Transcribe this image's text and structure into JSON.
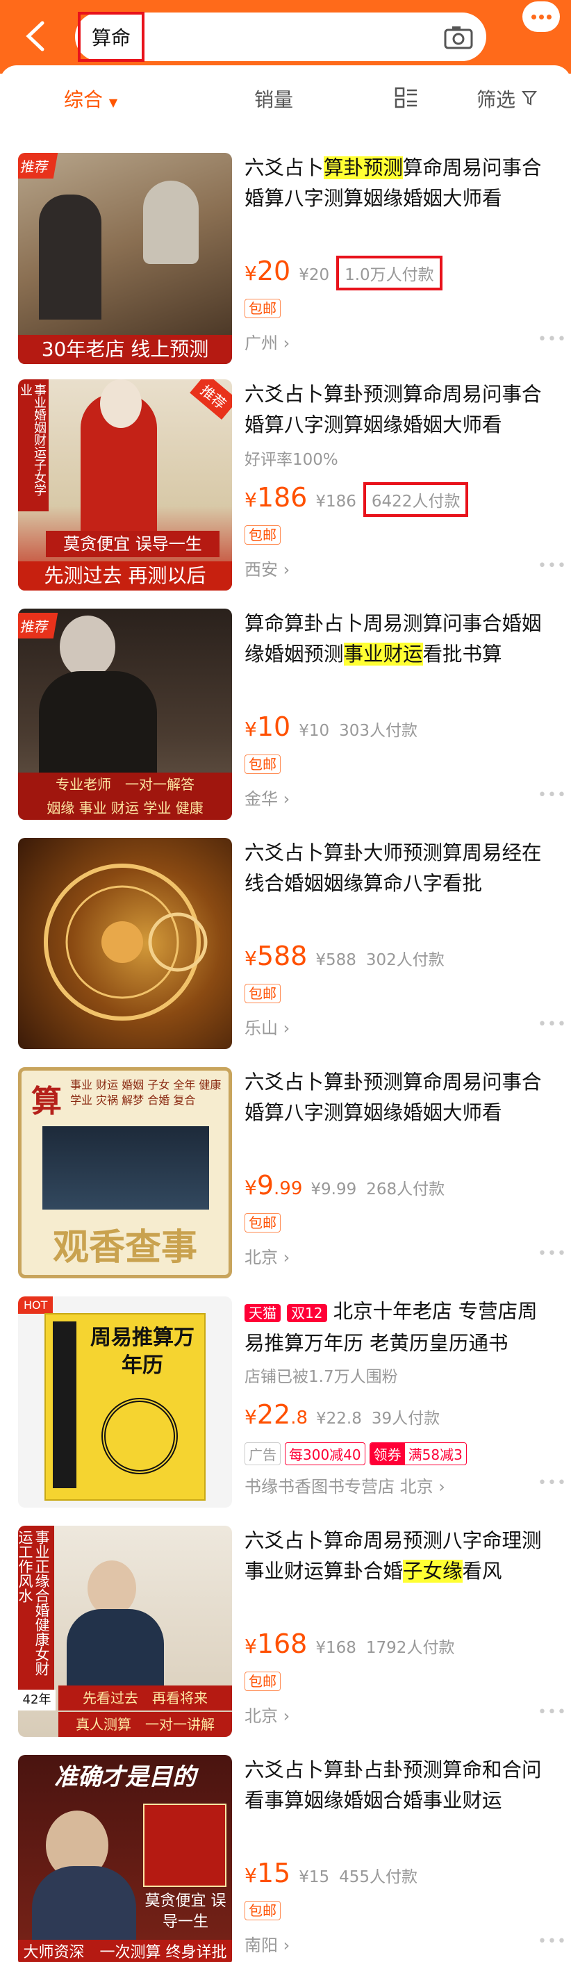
{
  "search": {
    "query": "算命"
  },
  "tabs": {
    "comprehensive": "综合",
    "sales": "销量",
    "filter": "筛选"
  },
  "products": [
    {
      "title_pre": "六爻占卜",
      "title_hl": "算卦预测",
      "title_post": "算命周易问事合婚算八字测算姻缘婚姻大师看",
      "price_int": "20",
      "price_dec": "",
      "orig": "¥20",
      "paid": "1.0万人付款",
      "paid_boxed": true,
      "tag": "包邮",
      "loc": "广州",
      "thumb_badge": "推荐",
      "thumb_caption": "30年老店 线上预测"
    },
    {
      "title_pre": "六爻占卜算卦预测算命周易问事合婚算八字测算姻缘婚姻大师看",
      "title_hl": "",
      "title_post": "",
      "sub": "好评率100%",
      "price_int": "186",
      "price_dec": "",
      "orig": "¥186",
      "paid": "6422人付款",
      "paid_boxed": true,
      "tag": "包邮",
      "loc": "西安",
      "thumb_badge": "推荐",
      "thumb_side": "事业婚姻财运子女学业",
      "thumb_caption1": "莫贪便宜 误导一生",
      "thumb_caption": "先测过去 再测以后"
    },
    {
      "title_pre": "算命算卦占卜周易测算问事合婚姻缘婚姻预测",
      "title_hl": "事业财运",
      "title_post": "看批书算",
      "price_int": "10",
      "price_dec": "",
      "orig": "¥10",
      "paid": "303人付款",
      "tag": "包邮",
      "loc": "金华",
      "thumb_badge": "推荐",
      "thumb_caption1": "专业老师　一对一解答",
      "thumb_caption": "姻缘 事业 财运 学业 健康"
    },
    {
      "title_pre": "六爻占卜算卦大师预测算周易经在线合婚姻姻缘算命八字看批",
      "title_hl": "",
      "title_post": "",
      "price_int": "588",
      "price_dec": "",
      "orig": "¥588",
      "paid": "302人付款",
      "tag": "包邮",
      "loc": "乐山"
    },
    {
      "title_pre": "六爻占卜算卦预测算命周易问事合婚算八字测算姻缘婚姻大师看",
      "title_hl": "",
      "title_post": "",
      "price_int": "9",
      "price_dec": ".99",
      "orig": "¥9.99",
      "paid": "268人付款",
      "tag": "包邮",
      "loc": "北京",
      "thumb_big": "观香查事",
      "thumb_top": "算",
      "thumb_words": "事业 财运 婚姻 子女 全年 健康 学业 灾祸 解梦 合婚 复合"
    },
    {
      "badge1": "天猫",
      "badge2": "双12",
      "title_pre": "北京十年老店 专营店周易推算万年历 老黄历皇历通书",
      "title_hl": "",
      "title_post": "",
      "sub": "店铺已被1.7万人围粉",
      "price_int": "22",
      "price_dec": ".8",
      "orig": "¥22.8",
      "paid": "39人付款",
      "ad": "广告",
      "coupon1": "每300减40",
      "coupon2": "领券",
      "coupon3": "满58减3",
      "loc": "书缘书香图书专营店 北京",
      "thumb_book": "周易推算万年历",
      "thumb_hot": "HOT"
    },
    {
      "title_pre": "六爻占卜算命周易预测八字命理测事业财运算卦合婚",
      "title_hl": "子女缘",
      "title_post": "看风",
      "price_int": "168",
      "price_dec": "",
      "orig": "¥168",
      "paid": "1792人付款",
      "tag": "包邮",
      "loc": "北京",
      "thumb_side": "事业正缘合婚健康女财运工作风水",
      "thumb_years": "42年",
      "thumb_caption1": "先看过去　再看将来",
      "thumb_caption": "真人测算　一对一讲解"
    },
    {
      "title_pre": "六爻占卜算卦占卦预测算命和合问看事算姻缘婚姻合婚事业财运",
      "title_hl": "",
      "title_post": "",
      "price_int": "15",
      "price_dec": "",
      "orig": "¥15",
      "paid": "455人付款",
      "tag": "包邮",
      "loc": "南阳",
      "thumb_top": "准确才是目的",
      "thumb_caption1": "莫贪便宜 误导一生",
      "thumb_caption": "大师资深　一次测算 终身详批"
    }
  ]
}
